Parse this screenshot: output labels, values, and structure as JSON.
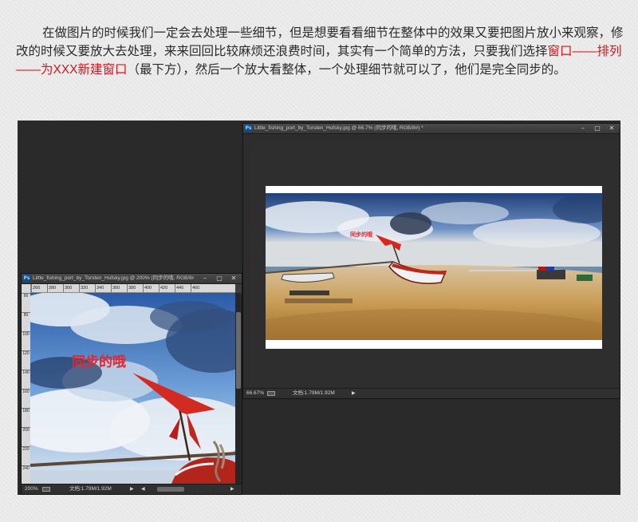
{
  "article": {
    "part1": "在做图片的时候我们一定会去处理一些细节，但是想要看看细节在整体中的效果又要把图片放小来观察，修改的时候又要放大去处理，来来回回比较麻烦还浪费时间，其实有一个简单的方法，只要我们选择",
    "highlight": "窗口——排列——为XXX新建窗口",
    "part2": "（最下方），然后一个放大看整体，一个处理细节就可以了，他们是完全同步的。",
    "highlight_color": "#d6141c"
  },
  "app_icon_label": "Ps",
  "windows": {
    "right": {
      "title": "Little_fishing_port_by_Torsten_Hufsky.jpg @ 66.7% (同步的哦, RGB/8#) *",
      "zoom": "66.67%",
      "doc_info": "文档:1.79M/1.92M"
    },
    "left": {
      "title": "Little_fishing_port_by_Torsten_Hufsky.jpg @ 200% (同步的哦, RGB/8#) *",
      "zoom": "200%",
      "doc_info": "文档:1.79M/1.92M",
      "ruler_h": [
        "260",
        "280",
        "300",
        "320",
        "340",
        "360",
        "380",
        "400",
        "420",
        "440",
        "460"
      ],
      "ruler_v": [
        "60",
        "80",
        "100",
        "120",
        "140",
        "160",
        "180",
        "200",
        "220",
        "240"
      ]
    },
    "buttons": {
      "minimize": "–",
      "restore": "▢",
      "close": "✕"
    }
  },
  "photo_overlay_text": "同步的哦",
  "colors": {
    "workspace": "#2a2a2a",
    "overlay_text": "#e8252b",
    "ps_icon": "#0b4f8f"
  }
}
